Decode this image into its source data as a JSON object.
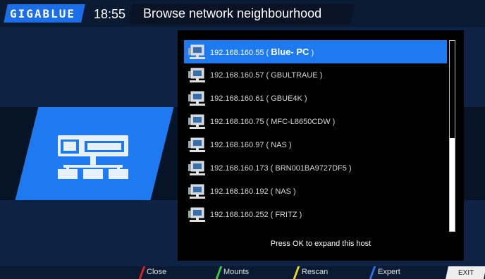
{
  "header": {
    "logo": "GIGABLUE",
    "clock": "18:55",
    "title": "Browse network neighbourhood"
  },
  "hosts": [
    {
      "ip": "192.168.160.55",
      "name": "Blue- PC",
      "selected": true
    },
    {
      "ip": "192.168.160.57",
      "name": "GBULTRAUE",
      "selected": false
    },
    {
      "ip": "192.168.160.61",
      "name": "GBUE4K",
      "selected": false
    },
    {
      "ip": "192.168.160.75",
      "name": "MFC-L8650CDW",
      "selected": false
    },
    {
      "ip": "192.168.160.97",
      "name": "NAS",
      "selected": false
    },
    {
      "ip": "192.168.160.173",
      "name": "BRN001BA9727DF5",
      "selected": false
    },
    {
      "ip": "192.168.160.192",
      "name": "NAS",
      "selected": false
    },
    {
      "ip": "192.168.160.252",
      "name": "FRITZ",
      "selected": false
    }
  ],
  "rows_text": [
    "192.168.160.55 ( ",
    "192.168.160.57 ( GBULTRAUE )",
    "192.168.160.61 ( GBUE4K )",
    "192.168.160.75 ( MFC-L8650CDW )",
    "192.168.160.97 ( NAS )",
    "192.168.160.173 ( BRN001BA9727DF5 )",
    "192.168.160.192 ( NAS )",
    "192.168.160.252 ( FRITZ )"
  ],
  "hint": "Press OK to expand this host",
  "footer": {
    "red": "Close",
    "green": "Mounts",
    "yellow": "Rescan",
    "blue": "Expert",
    "exit": "EXIT"
  },
  "colors": {
    "accent": "#1e7af0",
    "red": "#e02020",
    "green": "#3ccf3c",
    "yellow": "#e8d820",
    "blue": "#2a6ff0"
  }
}
